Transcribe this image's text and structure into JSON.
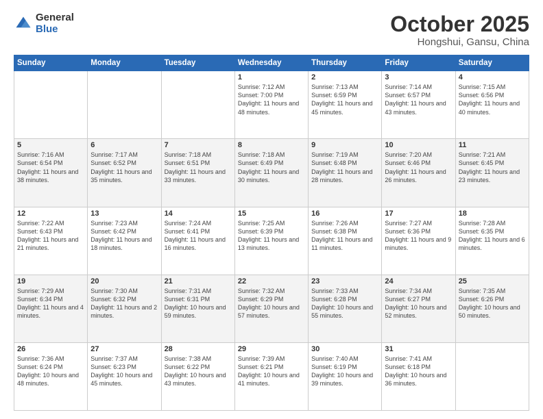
{
  "logo": {
    "general": "General",
    "blue": "Blue"
  },
  "title": {
    "month": "October 2025",
    "location": "Hongshui, Gansu, China"
  },
  "days_of_week": [
    "Sunday",
    "Monday",
    "Tuesday",
    "Wednesday",
    "Thursday",
    "Friday",
    "Saturday"
  ],
  "weeks": [
    [
      {
        "day": "",
        "info": ""
      },
      {
        "day": "",
        "info": ""
      },
      {
        "day": "",
        "info": ""
      },
      {
        "day": "1",
        "info": "Sunrise: 7:12 AM\nSunset: 7:00 PM\nDaylight: 11 hours\nand 48 minutes."
      },
      {
        "day": "2",
        "info": "Sunrise: 7:13 AM\nSunset: 6:59 PM\nDaylight: 11 hours\nand 45 minutes."
      },
      {
        "day": "3",
        "info": "Sunrise: 7:14 AM\nSunset: 6:57 PM\nDaylight: 11 hours\nand 43 minutes."
      },
      {
        "day": "4",
        "info": "Sunrise: 7:15 AM\nSunset: 6:56 PM\nDaylight: 11 hours\nand 40 minutes."
      }
    ],
    [
      {
        "day": "5",
        "info": "Sunrise: 7:16 AM\nSunset: 6:54 PM\nDaylight: 11 hours\nand 38 minutes."
      },
      {
        "day": "6",
        "info": "Sunrise: 7:17 AM\nSunset: 6:52 PM\nDaylight: 11 hours\nand 35 minutes."
      },
      {
        "day": "7",
        "info": "Sunrise: 7:18 AM\nSunset: 6:51 PM\nDaylight: 11 hours\nand 33 minutes."
      },
      {
        "day": "8",
        "info": "Sunrise: 7:18 AM\nSunset: 6:49 PM\nDaylight: 11 hours\nand 30 minutes."
      },
      {
        "day": "9",
        "info": "Sunrise: 7:19 AM\nSunset: 6:48 PM\nDaylight: 11 hours\nand 28 minutes."
      },
      {
        "day": "10",
        "info": "Sunrise: 7:20 AM\nSunset: 6:46 PM\nDaylight: 11 hours\nand 26 minutes."
      },
      {
        "day": "11",
        "info": "Sunrise: 7:21 AM\nSunset: 6:45 PM\nDaylight: 11 hours\nand 23 minutes."
      }
    ],
    [
      {
        "day": "12",
        "info": "Sunrise: 7:22 AM\nSunset: 6:43 PM\nDaylight: 11 hours\nand 21 minutes."
      },
      {
        "day": "13",
        "info": "Sunrise: 7:23 AM\nSunset: 6:42 PM\nDaylight: 11 hours\nand 18 minutes."
      },
      {
        "day": "14",
        "info": "Sunrise: 7:24 AM\nSunset: 6:41 PM\nDaylight: 11 hours\nand 16 minutes."
      },
      {
        "day": "15",
        "info": "Sunrise: 7:25 AM\nSunset: 6:39 PM\nDaylight: 11 hours\nand 13 minutes."
      },
      {
        "day": "16",
        "info": "Sunrise: 7:26 AM\nSunset: 6:38 PM\nDaylight: 11 hours\nand 11 minutes."
      },
      {
        "day": "17",
        "info": "Sunrise: 7:27 AM\nSunset: 6:36 PM\nDaylight: 11 hours\nand 9 minutes."
      },
      {
        "day": "18",
        "info": "Sunrise: 7:28 AM\nSunset: 6:35 PM\nDaylight: 11 hours\nand 6 minutes."
      }
    ],
    [
      {
        "day": "19",
        "info": "Sunrise: 7:29 AM\nSunset: 6:34 PM\nDaylight: 11 hours\nand 4 minutes."
      },
      {
        "day": "20",
        "info": "Sunrise: 7:30 AM\nSunset: 6:32 PM\nDaylight: 11 hours\nand 2 minutes."
      },
      {
        "day": "21",
        "info": "Sunrise: 7:31 AM\nSunset: 6:31 PM\nDaylight: 10 hours\nand 59 minutes."
      },
      {
        "day": "22",
        "info": "Sunrise: 7:32 AM\nSunset: 6:29 PM\nDaylight: 10 hours\nand 57 minutes."
      },
      {
        "day": "23",
        "info": "Sunrise: 7:33 AM\nSunset: 6:28 PM\nDaylight: 10 hours\nand 55 minutes."
      },
      {
        "day": "24",
        "info": "Sunrise: 7:34 AM\nSunset: 6:27 PM\nDaylight: 10 hours\nand 52 minutes."
      },
      {
        "day": "25",
        "info": "Sunrise: 7:35 AM\nSunset: 6:26 PM\nDaylight: 10 hours\nand 50 minutes."
      }
    ],
    [
      {
        "day": "26",
        "info": "Sunrise: 7:36 AM\nSunset: 6:24 PM\nDaylight: 10 hours\nand 48 minutes."
      },
      {
        "day": "27",
        "info": "Sunrise: 7:37 AM\nSunset: 6:23 PM\nDaylight: 10 hours\nand 45 minutes."
      },
      {
        "day": "28",
        "info": "Sunrise: 7:38 AM\nSunset: 6:22 PM\nDaylight: 10 hours\nand 43 minutes."
      },
      {
        "day": "29",
        "info": "Sunrise: 7:39 AM\nSunset: 6:21 PM\nDaylight: 10 hours\nand 41 minutes."
      },
      {
        "day": "30",
        "info": "Sunrise: 7:40 AM\nSunset: 6:19 PM\nDaylight: 10 hours\nand 39 minutes."
      },
      {
        "day": "31",
        "info": "Sunrise: 7:41 AM\nSunset: 6:18 PM\nDaylight: 10 hours\nand 36 minutes."
      },
      {
        "day": "",
        "info": ""
      }
    ]
  ]
}
